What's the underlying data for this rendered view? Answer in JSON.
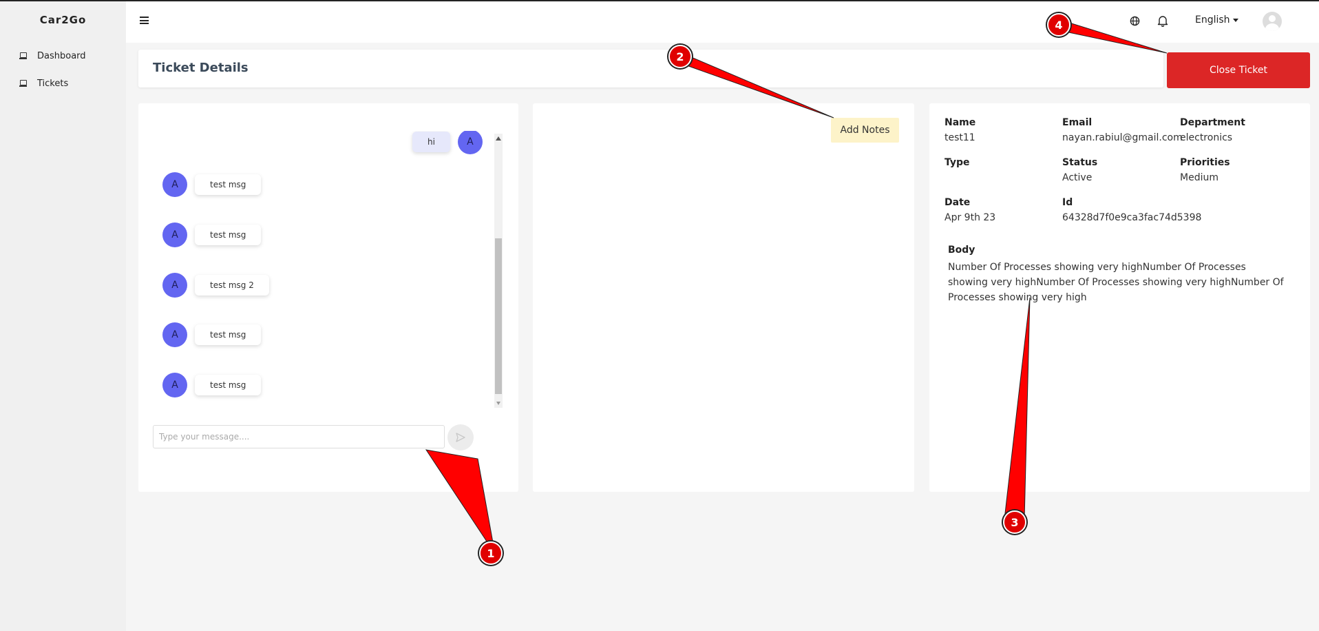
{
  "app": {
    "brand": "Car2Go"
  },
  "sidebar": {
    "items": [
      {
        "label": "Dashboard",
        "icon": "laptop-icon"
      },
      {
        "label": "Tickets",
        "icon": "laptop-icon"
      }
    ]
  },
  "header": {
    "language": "English",
    "icons": [
      "menu-icon",
      "globe-icon",
      "bell-icon",
      "user-avatar"
    ]
  },
  "page": {
    "title": "Ticket Details",
    "close_label": "Close Ticket"
  },
  "chat": {
    "self_message": {
      "text": "hi",
      "avatar": "A"
    },
    "messages": [
      {
        "avatar": "A",
        "text": "test msg"
      },
      {
        "avatar": "A",
        "text": "test msg"
      },
      {
        "avatar": "A",
        "text": "test msg 2"
      },
      {
        "avatar": "A",
        "text": "test msg"
      },
      {
        "avatar": "A",
        "text": "test msg"
      }
    ],
    "input_value": "",
    "input_placeholder": "Type your message...."
  },
  "notes": {
    "add_label": "Add Notes"
  },
  "details": {
    "fields": [
      {
        "label": "Name",
        "value": "test11"
      },
      {
        "label": "Email",
        "value": "nayan.rabiul@gmail.com"
      },
      {
        "label": "Department",
        "value": "electronics"
      },
      {
        "label": "Type",
        "value": ""
      },
      {
        "label": "Status",
        "value": "Active"
      },
      {
        "label": "Priorities",
        "value": "Medium"
      },
      {
        "label": "Date",
        "value": "Apr 9th 23"
      },
      {
        "label": "Id",
        "value": "64328d7f0e9ca3fac74d5398"
      }
    ],
    "body_label": "Body",
    "body_text": "Number Of Processes showing very highNumber Of Processes showing very highNumber Of Processes showing very highNumber Of Processes showing very high"
  },
  "annotations": {
    "labels": [
      "1",
      "2",
      "3",
      "4"
    ],
    "color": "#e00000"
  },
  "colors": {
    "accent": "#6366f1",
    "danger": "#dc2626",
    "notes_bg": "#fdf3c9"
  }
}
